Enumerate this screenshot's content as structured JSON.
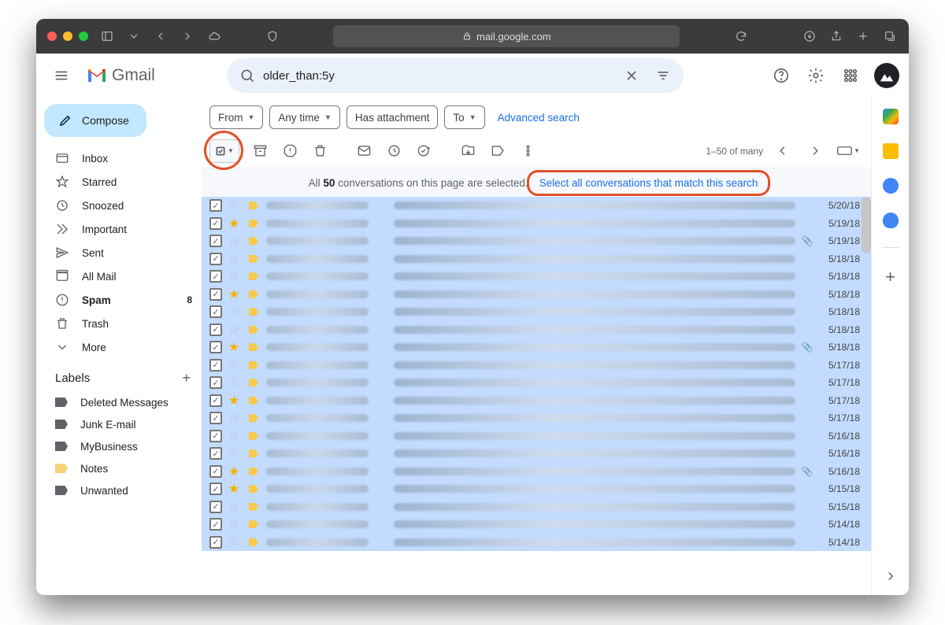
{
  "browser": {
    "url": "mail.google.com"
  },
  "header": {
    "product": "Gmail",
    "search_value": "older_than:5y"
  },
  "sidebar": {
    "compose": "Compose",
    "nav": [
      {
        "label": "Inbox",
        "bold": false,
        "count": ""
      },
      {
        "label": "Starred",
        "bold": false,
        "count": ""
      },
      {
        "label": "Snoozed",
        "bold": false,
        "count": ""
      },
      {
        "label": "Important",
        "bold": false,
        "count": ""
      },
      {
        "label": "Sent",
        "bold": false,
        "count": ""
      },
      {
        "label": "All Mail",
        "bold": false,
        "count": ""
      },
      {
        "label": "Spam",
        "bold": true,
        "count": "8"
      },
      {
        "label": "Trash",
        "bold": false,
        "count": ""
      },
      {
        "label": "More",
        "bold": false,
        "count": ""
      }
    ],
    "labels_heading": "Labels",
    "labels": [
      {
        "label": "Deleted Messages",
        "yellow": false
      },
      {
        "label": "Junk E-mail",
        "yellow": false
      },
      {
        "label": "MyBusiness",
        "yellow": false
      },
      {
        "label": "Notes",
        "yellow": true
      },
      {
        "label": "Unwanted",
        "yellow": false
      }
    ]
  },
  "filters": {
    "from": "From",
    "anytime": "Any time",
    "has_att": "Has attachment",
    "to": "To",
    "advanced": "Advanced search"
  },
  "pager": "1–50 of many",
  "banner": {
    "prefix": "All ",
    "count": "50",
    "suffix": " conversations on this page are selected.",
    "link": "Select all conversations that match this search"
  },
  "rows": [
    {
      "star": false,
      "clip": false,
      "date": "5/20/18"
    },
    {
      "star": true,
      "clip": false,
      "date": "5/19/18"
    },
    {
      "star": false,
      "clip": true,
      "date": "5/19/18"
    },
    {
      "star": false,
      "clip": false,
      "date": "5/18/18"
    },
    {
      "star": false,
      "clip": false,
      "date": "5/18/18"
    },
    {
      "star": true,
      "clip": false,
      "date": "5/18/18"
    },
    {
      "star": false,
      "clip": false,
      "date": "5/18/18"
    },
    {
      "star": false,
      "clip": false,
      "date": "5/18/18"
    },
    {
      "star": true,
      "clip": true,
      "date": "5/18/18"
    },
    {
      "star": false,
      "clip": false,
      "date": "5/17/18"
    },
    {
      "star": false,
      "clip": false,
      "date": "5/17/18"
    },
    {
      "star": true,
      "clip": false,
      "date": "5/17/18"
    },
    {
      "star": false,
      "clip": false,
      "date": "5/17/18"
    },
    {
      "star": false,
      "clip": false,
      "date": "5/16/18"
    },
    {
      "star": false,
      "clip": false,
      "date": "5/16/18"
    },
    {
      "star": true,
      "clip": true,
      "date": "5/16/18"
    },
    {
      "star": true,
      "clip": false,
      "date": "5/15/18"
    },
    {
      "star": false,
      "clip": false,
      "date": "5/15/18"
    },
    {
      "star": false,
      "clip": false,
      "date": "5/14/18"
    },
    {
      "star": false,
      "clip": false,
      "date": "5/14/18"
    }
  ]
}
